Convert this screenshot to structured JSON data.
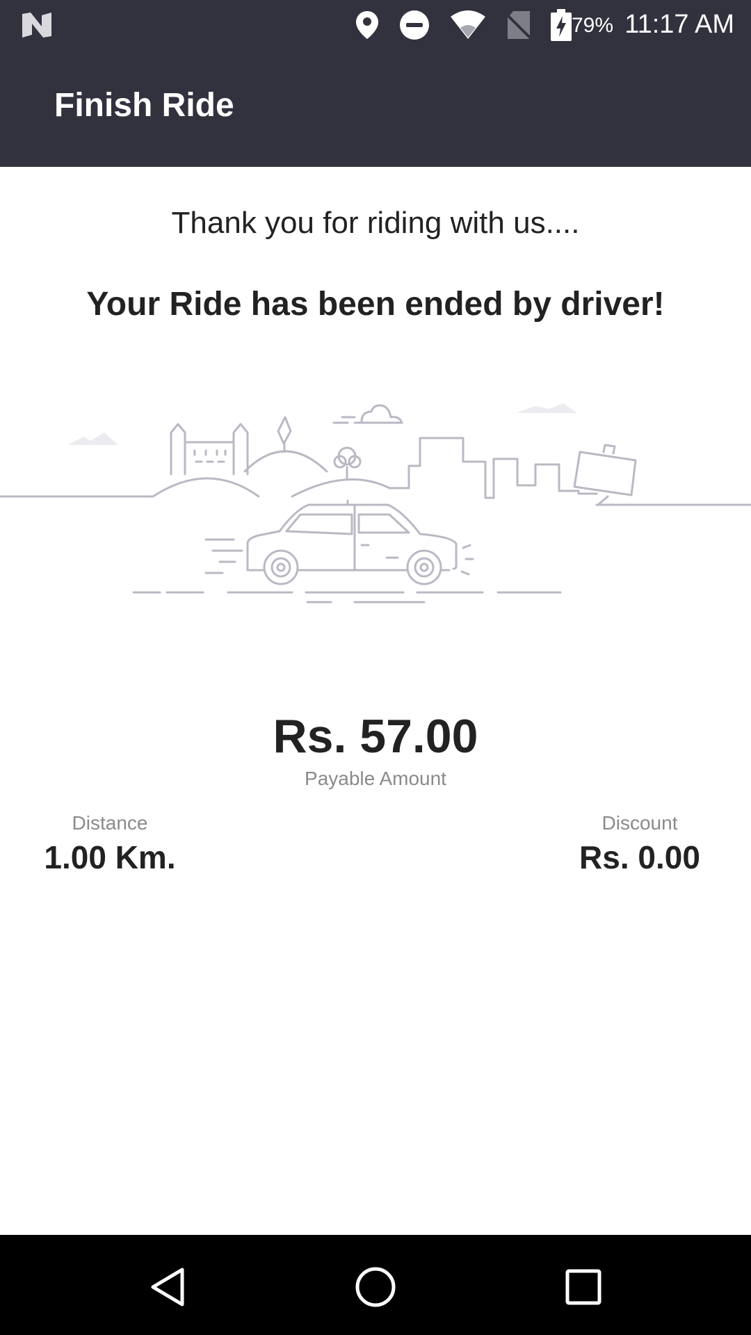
{
  "status_bar": {
    "battery_percent": "79%",
    "time": "11:17 AM",
    "icons": [
      "notification-n-icon",
      "location-pin-icon",
      "do-not-disturb-icon",
      "wifi-icon",
      "no-sim-icon",
      "battery-charging-icon"
    ]
  },
  "app_bar": {
    "title": "Finish Ride"
  },
  "main": {
    "thanks_text": "Thank you for riding with us....",
    "ended_text": "Your Ride has been ended by driver!",
    "illustration_icon": "city-car-illustration",
    "payable": {
      "amount": "Rs. 57.00",
      "label": "Payable Amount"
    },
    "distance": {
      "label": "Distance",
      "value": "1.00 Km."
    },
    "discount": {
      "label": "Discount",
      "value": "Rs. 0.00"
    }
  },
  "nav_bar": {
    "icons": [
      "back-icon",
      "home-icon",
      "recents-icon"
    ]
  },
  "colors": {
    "header": "#32323f",
    "text": "#222222",
    "muted": "#8a8a8a",
    "illustration": "#b9b9c4"
  }
}
